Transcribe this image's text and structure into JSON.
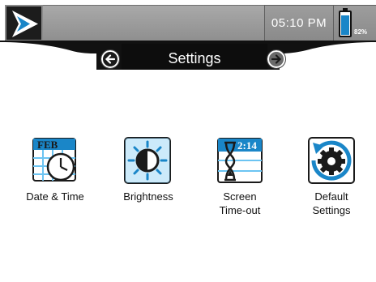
{
  "status_bar": {
    "time": "05:10 PM",
    "battery_percent": "82%",
    "battery_level": 0.82
  },
  "header": {
    "title": "Settings"
  },
  "settings_items": [
    {
      "label": "Date & Time",
      "icon": "calendar-clock-icon",
      "calendar_month": "FEB"
    },
    {
      "label": "Brightness",
      "icon": "brightness-icon"
    },
    {
      "label": "Screen\nTime-out",
      "icon": "hourglass-timer-icon",
      "timer_text": "2:14"
    },
    {
      "label": "Default\nSettings",
      "icon": "reset-gear-icon"
    }
  ],
  "colors": {
    "accent": "#1a86c8",
    "accent_light": "#6cc4f2",
    "header_bar": "#111111",
    "status_gray": "#999999"
  }
}
